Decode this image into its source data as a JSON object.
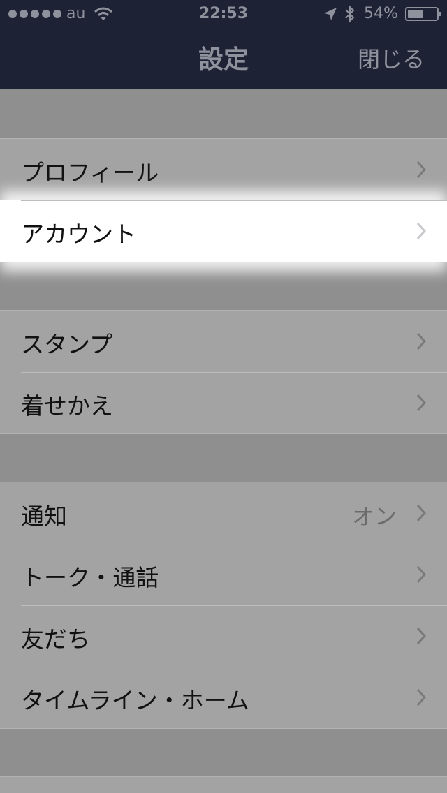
{
  "status_bar": {
    "carrier": "au",
    "time": "22:53",
    "battery_percent": "54%",
    "battery_level": 0.54,
    "icons": [
      "signal-dots",
      "wifi-icon",
      "location-arrow-icon",
      "bluetooth-icon",
      "battery-icon"
    ]
  },
  "nav": {
    "title": "設定",
    "close_label": "閉じる"
  },
  "groups": [
    {
      "items": [
        {
          "label": "プロフィール",
          "highlighted": false
        },
        {
          "label": "アカウント",
          "highlighted": true
        }
      ]
    },
    {
      "items": [
        {
          "label": "スタンプ"
        },
        {
          "label": "着せかえ"
        }
      ]
    },
    {
      "items": [
        {
          "label": "通知",
          "value": "オン"
        },
        {
          "label": "トーク・通話"
        },
        {
          "label": "友だち"
        },
        {
          "label": "タイムライン・ホーム"
        }
      ]
    }
  ],
  "colors": {
    "navbar": "#1d2334",
    "background": "#8f8f8f",
    "row": "#a3a3a3",
    "highlight": "#ffffff"
  }
}
